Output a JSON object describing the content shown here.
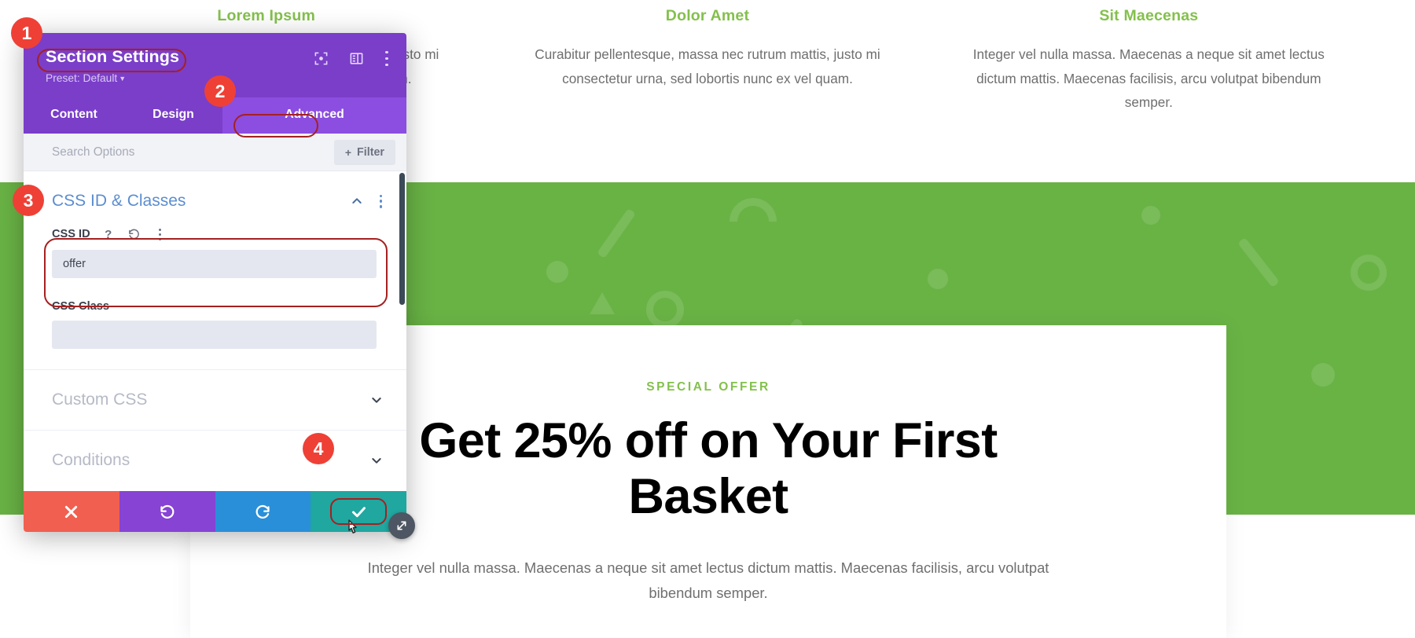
{
  "page": {
    "columns": [
      {
        "title": "Lorem Ipsum",
        "body": "Curabitur pellentesque, massa nec rutrum mattis, justo mi consectetur urna, sed lobortis nunc ex vel quam."
      },
      {
        "title": "Dolor Amet",
        "body": "Curabitur pellentesque, massa nec rutrum mattis, justo mi consectetur urna, sed lobortis nunc ex vel quam."
      },
      {
        "title": "Sit Maecenas",
        "body": "Integer vel nulla massa. Maecenas a neque sit amet lectus dictum mattis. Maecenas facilisis, arcu volutpat bibendum semper."
      }
    ],
    "offer": {
      "eyebrow": "SPECIAL OFFER",
      "title": "Get 25% off on Your First Basket",
      "subtitle": "Integer vel nulla massa. Maecenas a neque sit amet lectus dictum mattis. Maecenas facilisis, arcu volutpat bibendum semper."
    },
    "colors": {
      "green_band": "#69b345",
      "accent_green": "#84c04d",
      "body_text": "#6f6f6f"
    }
  },
  "modal": {
    "title": "Section Settings",
    "preset": "Preset: Default",
    "header_icons": [
      "focus-icon",
      "layout-panel-icon",
      "more-options-icon"
    ],
    "tabs": [
      {
        "label": "Content",
        "active": false
      },
      {
        "label": "Design",
        "active": false
      },
      {
        "label": "Advanced",
        "active": true
      }
    ],
    "search": {
      "placeholder": "Search Options",
      "filter_label": "Filter",
      "filter_plus": "+"
    },
    "sections": [
      {
        "title": "CSS ID & Classes",
        "expanded": true,
        "fields": [
          {
            "label": "CSS ID",
            "value": "offer",
            "icons": [
              "help-icon",
              "reset-icon",
              "more-options-icon"
            ]
          },
          {
            "label": "CSS Class",
            "value": "",
            "icons": []
          }
        ]
      },
      {
        "title": "Custom CSS",
        "expanded": false
      },
      {
        "title": "Conditions",
        "expanded": false
      }
    ],
    "actions": [
      {
        "name": "cancel",
        "icon": "close-icon",
        "color": "#f15f50"
      },
      {
        "name": "undo",
        "icon": "undo-icon",
        "color": "#8643d4"
      },
      {
        "name": "redo",
        "icon": "redo-icon",
        "color": "#2a8fd9"
      },
      {
        "name": "save",
        "icon": "checkmark-icon",
        "color": "#1fa7a0"
      }
    ],
    "colors": {
      "header": "#7a3ec9",
      "tab_active": "#8c4ee0",
      "section_title": "#5b8dd0"
    }
  },
  "annotations": {
    "badges": [
      {
        "number": "1",
        "target": "Section Settings title"
      },
      {
        "number": "2",
        "target": "Advanced tab"
      },
      {
        "number": "3",
        "target": "CSS ID field"
      },
      {
        "number": "4",
        "target": "Save checkmark button"
      }
    ],
    "highlight_color": "#a62020",
    "badge_color": "#ef4036"
  }
}
